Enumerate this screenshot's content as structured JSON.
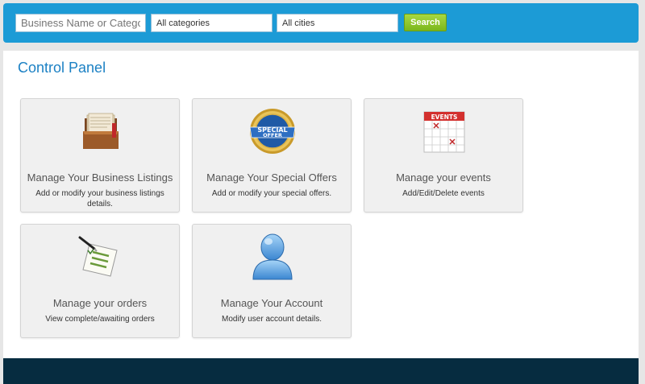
{
  "search": {
    "query_placeholder": "Business Name or Category",
    "category_value": "All categories",
    "city_value": "All cities",
    "button_label": "Search"
  },
  "panel": {
    "title": "Control Panel",
    "cards": [
      {
        "title": "Manage Your Business Listings",
        "desc": "Add or modify your business listings details.",
        "icon": "business-listings-icon"
      },
      {
        "title": "Manage Your Special Offers",
        "desc": "Add or modify your special offers.",
        "icon": "special-offer-badge-icon",
        "badge_lines": [
          "SPECIAL",
          "OFFER"
        ]
      },
      {
        "title": "Manage your events",
        "desc": "Add/Edit/Delete events",
        "icon": "events-calendar-icon",
        "calendar_label": "EVENTS"
      },
      {
        "title": "Manage your orders",
        "desc": "View complete/awaiting orders",
        "icon": "orders-checklist-icon"
      },
      {
        "title": "Manage Your Account",
        "desc": "Modify user account details.",
        "icon": "user-account-icon"
      }
    ]
  },
  "colors": {
    "header_bg": "#1c9bd6",
    "search_button": "#8cc62e",
    "title_blue": "#1c81c4",
    "footer_bg": "#062c40"
  }
}
